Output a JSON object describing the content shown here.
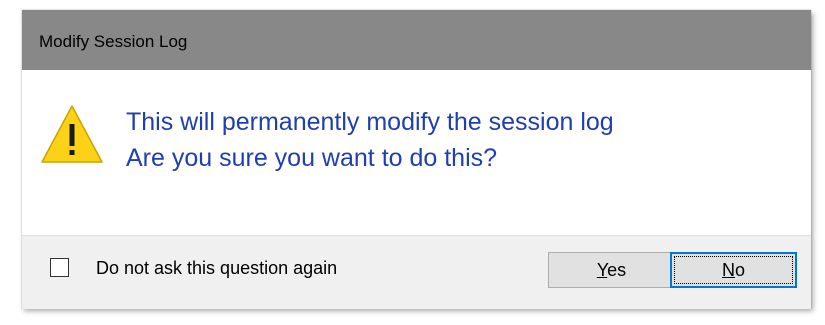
{
  "dialog": {
    "title": "Modify Session Log",
    "icon": "warning-icon",
    "message_line1": "This will permanently modify the session log",
    "message_line2": "Are you sure you want to do this?",
    "checkbox": {
      "label": "Do not ask this question again",
      "checked": false
    },
    "buttons": {
      "yes": {
        "accel": "Y",
        "rest": "es"
      },
      "no": {
        "accel": "N",
        "rest": "o"
      }
    },
    "colors": {
      "titlebar": "#888888",
      "message_text": "#1f3fb0",
      "footer": "#f0f0f0",
      "focus_border": "#0078d7",
      "warning_fill": "#fcd116"
    }
  }
}
